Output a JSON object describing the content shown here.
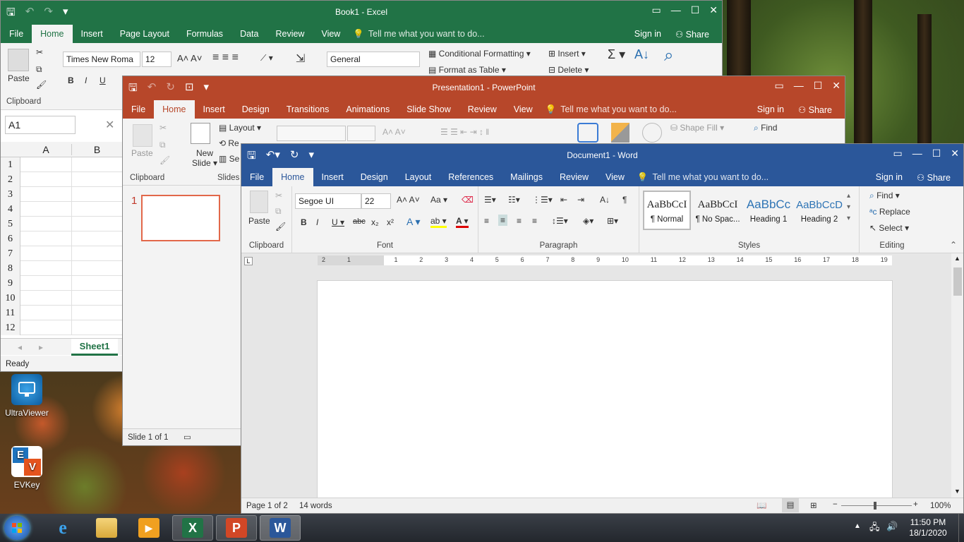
{
  "desktop": {
    "icons": [
      {
        "label": "UltraViewer"
      },
      {
        "label": "EVKey"
      }
    ]
  },
  "excel": {
    "title": "Book1 - Excel",
    "tabs": [
      "File",
      "Home",
      "Insert",
      "Page Layout",
      "Formulas",
      "Data",
      "Review",
      "View"
    ],
    "tell_me": "Tell me what you want to do...",
    "sign_in": "Sign in",
    "share": "Share",
    "font_name": "Times New Roma",
    "font_size": "12",
    "number_format": "General",
    "conditional_formatting": "Conditional Formatting",
    "format_as_table": "Format as Table",
    "insert": "Insert",
    "delete": "Delete",
    "paste": "Paste",
    "clipboard": "Clipboard",
    "name_box": "A1",
    "columns": [
      "A",
      "B"
    ],
    "rows": [
      "1",
      "2",
      "3",
      "4",
      "5",
      "6",
      "7",
      "8",
      "9",
      "10",
      "11",
      "12"
    ],
    "sheet_tab": "Sheet1",
    "status": "Ready",
    "color": "#217346"
  },
  "powerpoint": {
    "title": "Presentation1 - PowerPoint",
    "tabs": [
      "File",
      "Home",
      "Insert",
      "Design",
      "Transitions",
      "Animations",
      "Slide Show",
      "Review",
      "View"
    ],
    "tell_me": "Tell me what you want to do...",
    "sign_in": "Sign in",
    "share": "Share",
    "paste": "Paste",
    "new_slide_1": "New",
    "new_slide_2": "Slide",
    "layout": "Layout",
    "reset": "Re",
    "section": "Se",
    "clipboard": "Clipboard",
    "slides": "Slides",
    "shape_fill": "Shape Fill",
    "find": "Find",
    "slide_number": "1",
    "status": "Slide 1 of 1",
    "color": "#b7472a"
  },
  "word": {
    "title": "Document1 - Word",
    "tabs": [
      "File",
      "Home",
      "Insert",
      "Design",
      "Layout",
      "References",
      "Mailings",
      "Review",
      "View"
    ],
    "tell_me": "Tell me what you want to do...",
    "sign_in": "Sign in",
    "share": "Share",
    "paste": "Paste",
    "font_name": "Segoe UI",
    "font_size": "22",
    "groups": {
      "clipboard": "Clipboard",
      "font": "Font",
      "paragraph": "Paragraph",
      "styles": "Styles",
      "editing": "Editing"
    },
    "styles": [
      {
        "preview": "AaBbCcI",
        "name": "¶ Normal"
      },
      {
        "preview": "AaBbCcI",
        "name": "¶ No Spac..."
      },
      {
        "preview": "AaBbCc",
        "name": "Heading 1"
      },
      {
        "preview": "AaBbCcD",
        "name": "Heading 2"
      }
    ],
    "editing": {
      "find": "Find",
      "replace": "Replace",
      "select": "Select"
    },
    "ruler": [
      "2",
      "1",
      "",
      "1",
      "2",
      "3",
      "4",
      "5",
      "6",
      "7",
      "8",
      "9",
      "10",
      "11",
      "12",
      "13",
      "14",
      "15",
      "16",
      "17",
      "18",
      "19"
    ],
    "status": {
      "page": "Page 1 of 2",
      "words": "14 words",
      "zoom": "100%"
    },
    "color": "#2b579a"
  },
  "taskbar": {
    "time": "11:50 PM",
    "date": "18/1/2020"
  }
}
